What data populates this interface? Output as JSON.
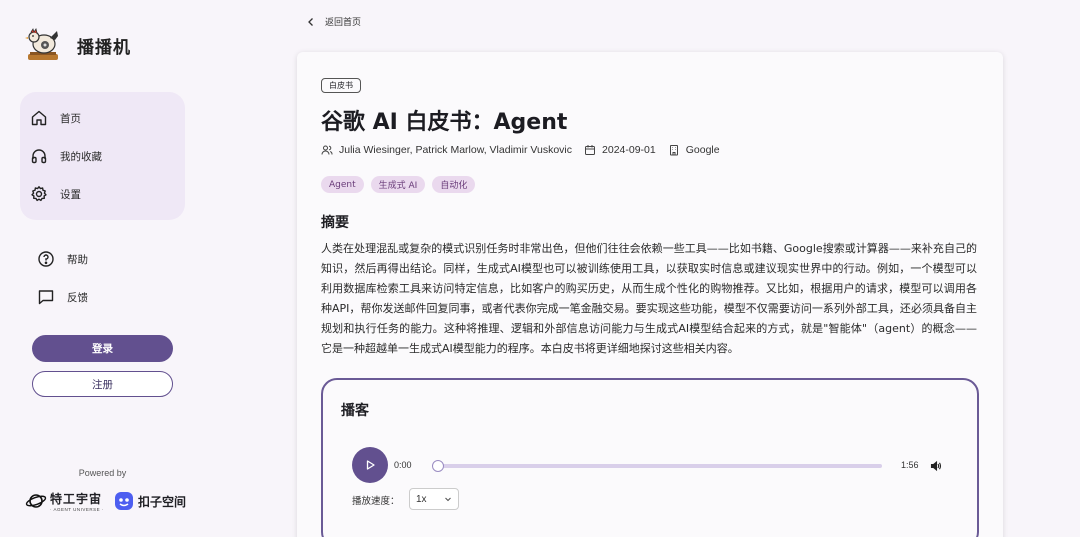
{
  "brand": {
    "name": "播播机"
  },
  "nav": {
    "items": [
      {
        "label": "首页",
        "icon": "home-icon"
      },
      {
        "label": "我的收藏",
        "icon": "headphones-icon"
      },
      {
        "label": "设置",
        "icon": "gear-icon"
      }
    ],
    "secondary": [
      {
        "label": "帮助",
        "icon": "help-circle-icon"
      },
      {
        "label": "反馈",
        "icon": "message-icon"
      }
    ]
  },
  "auth": {
    "login_label": "登录",
    "register_label": "注册"
  },
  "footer": {
    "powered_by": "Powered by",
    "partner_a": {
      "name": "特工宇宙",
      "sub": "· AGENT UNIVERSE ·"
    },
    "partner_b": {
      "name": "扣子空间"
    }
  },
  "back": {
    "label": "返回首页"
  },
  "article": {
    "category": "白皮书",
    "title": "谷歌 AI 白皮书：Agent",
    "authors": "Julia Wiesinger, Patrick Marlow, Vladimir Vuskovic",
    "date": "2024-09-01",
    "publisher": "Google",
    "tags": [
      "Agent",
      "生成式 AI",
      "自动化"
    ],
    "abstract_heading": "摘要",
    "abstract": "人类在处理混乱或复杂的模式识别任务时非常出色，但他们往往会依赖一些工具——比如书籍、Google搜索或计算器——来补充自己的知识，然后再得出结论。同样，生成式AI模型也可以被训练使用工具，以获取实时信息或建议现实世界中的行动。例如，一个模型可以利用数据库检索工具来访问特定信息，比如客户的购买历史，从而生成个性化的购物推荐。又比如，根据用户的请求，模型可以调用各种API，帮你发送邮件回复同事，或者代表你完成一笔金融交易。要实现这些功能，模型不仅需要访问一系列外部工具，还必须具备自主规划和执行任务的能力。这种将推理、逻辑和外部信息访问能力与生成式AI模型结合起来的方式，就是\"智能体\"（agent）的概念——它是一种超越单一生成式AI模型能力的程序。本白皮书将更详细地探讨这些相关内容。"
  },
  "podcast": {
    "heading": "播客",
    "current_time": "0:00",
    "total_time": "1:56",
    "progress": 0,
    "speed_label": "播放速度：",
    "speed_value": "1x"
  },
  "colors": {
    "accent": "#62508f",
    "nav_bg": "#efe8f6",
    "tag_bg": "#ead9ee",
    "track": "#d9cfea"
  }
}
